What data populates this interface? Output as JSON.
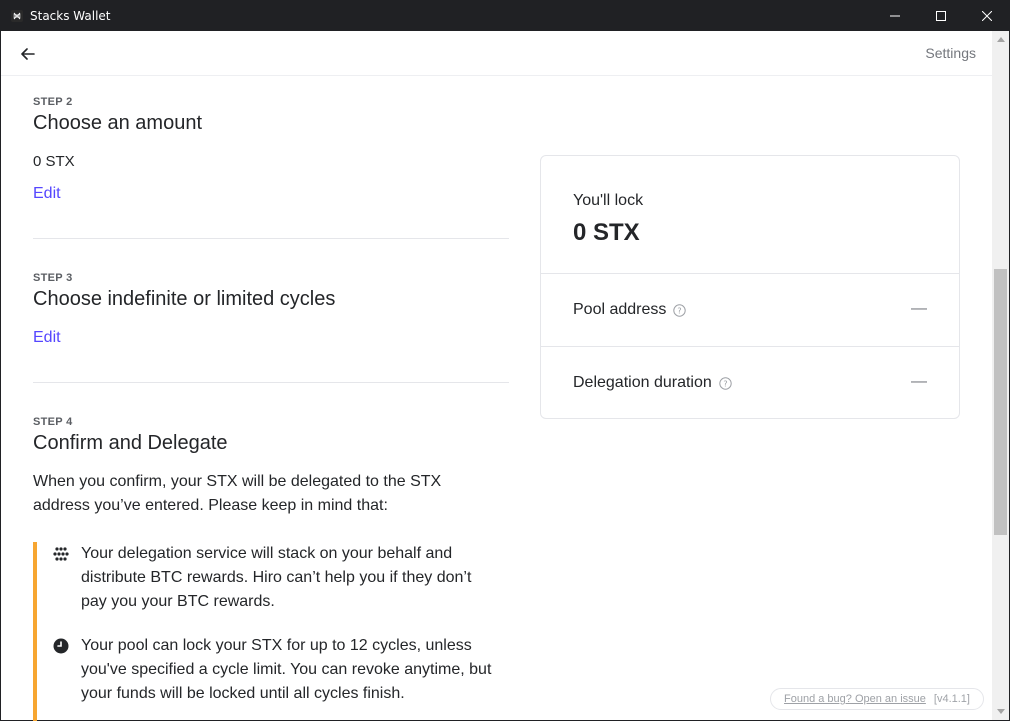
{
  "window": {
    "title": "Stacks Wallet"
  },
  "header": {
    "settings_label": "Settings"
  },
  "steps": [
    {
      "label": "STEP 2",
      "title": "Choose an amount",
      "value": "0 STX",
      "edit_label": "Edit"
    },
    {
      "label": "STEP 3",
      "title": "Choose indefinite or limited cycles",
      "edit_label": "Edit"
    },
    {
      "label": "STEP 4",
      "title": "Confirm and Delegate",
      "description": "When you confirm, your STX will be delegated to the STX address you’ve entered. Please keep in mind that:"
    }
  ],
  "notices": [
    {
      "icon": "stacks-dots-icon",
      "text": "Your delegation service will stack on your behalf and distribute BTC rewards. Hiro can’t help you if they don’t pay you your BTC rewards."
    },
    {
      "icon": "clock-icon",
      "text": "Your pool can lock your STX for up to 12 cycles, unless you've specified a cycle limit. You can revoke anytime, but your funds will be locked until all cycles finish."
    }
  ],
  "summary": {
    "lock_label": "You'll lock",
    "lock_value": "0 STX",
    "rows": [
      {
        "label": "Pool address",
        "value": "—"
      },
      {
        "label": "Delegation duration",
        "value": "—"
      }
    ]
  },
  "footer": {
    "bug_label": "Found a bug? Open an issue",
    "version": "[v4.1.1]"
  }
}
